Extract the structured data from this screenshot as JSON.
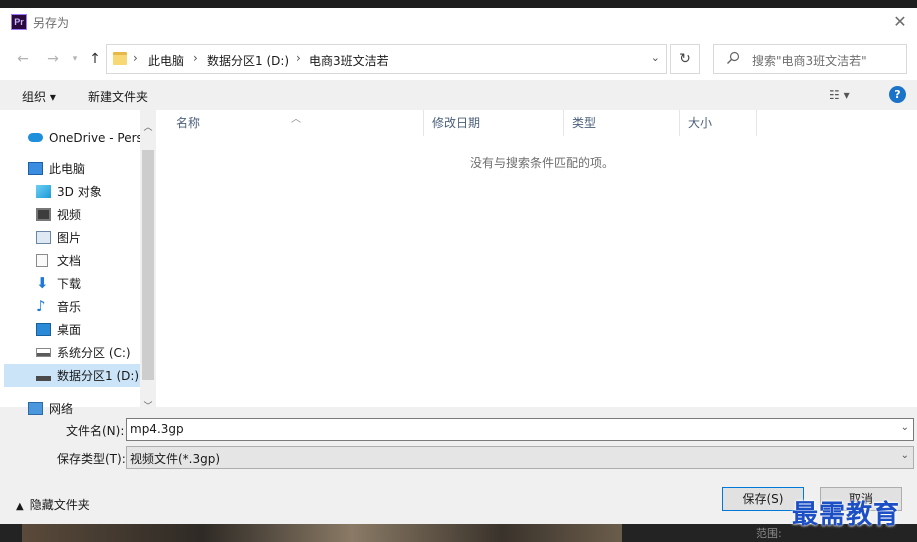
{
  "window": {
    "title": "另存为",
    "app_badge": "Pr"
  },
  "address": {
    "crumbs": [
      "此电脑",
      "数据分区1 (D:)",
      "电商3班文洁若"
    ],
    "search_placeholder": "搜索\"电商3班文洁若\""
  },
  "toolbar": {
    "organize": "组织 ▾",
    "new_folder": "新建文件夹",
    "view_icon": "view-options-icon",
    "help_icon": "help-icon"
  },
  "nav": {
    "items": [
      {
        "label": "OneDrive - Perso",
        "icon": "cloud-icon"
      },
      {
        "label": "此电脑",
        "icon": "computer-icon"
      },
      {
        "label": "3D 对象",
        "icon": "cube-icon"
      },
      {
        "label": "视频",
        "icon": "video-icon"
      },
      {
        "label": "图片",
        "icon": "pictures-icon"
      },
      {
        "label": "文档",
        "icon": "documents-icon"
      },
      {
        "label": "下载",
        "icon": "download-icon"
      },
      {
        "label": "音乐",
        "icon": "music-icon"
      },
      {
        "label": "桌面",
        "icon": "desktop-icon"
      },
      {
        "label": "系统分区 (C:)",
        "icon": "drive-icon"
      },
      {
        "label": "数据分区1 (D:)",
        "icon": "drive-icon"
      },
      {
        "label": "网络",
        "icon": "network-icon"
      }
    ]
  },
  "columns": [
    "名称",
    "修改日期",
    "类型",
    "大小"
  ],
  "empty_message": "没有与搜索条件匹配的项。",
  "form": {
    "filename_label": "文件名(N):",
    "filename_value": "mp4.3gp",
    "filetype_label": "保存类型(T):",
    "filetype_value": "视频文件(*.3gp)"
  },
  "footer": {
    "hide_folders": "隐藏文件夹",
    "save": "保存(S)",
    "cancel": "取消"
  },
  "background": {
    "label": "范围:"
  },
  "watermark": "最需教育",
  "colors": {
    "accent": "#0078d7",
    "selected": "#cce4f7",
    "watermark": "#1d4fc4"
  }
}
